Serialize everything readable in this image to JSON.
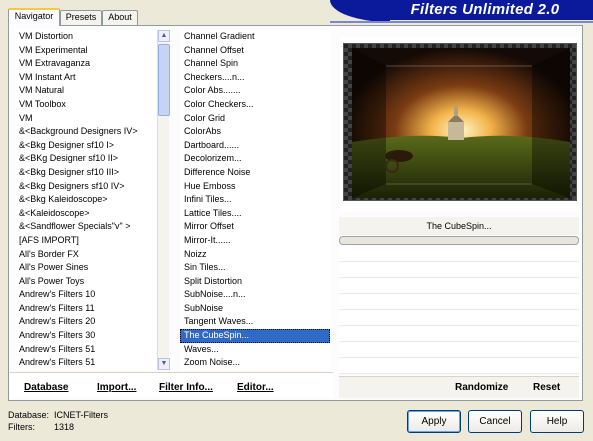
{
  "app": {
    "title": "Filters Unlimited 2.0"
  },
  "tabs": [
    {
      "label": "Navigator",
      "active": true
    },
    {
      "label": "Presets",
      "active": false
    },
    {
      "label": "About",
      "active": false
    }
  ],
  "categories": [
    "VM Distortion",
    "VM Experimental",
    "VM Extravaganza",
    "VM Instant Art",
    "VM Natural",
    "VM Toolbox",
    "VM",
    "&<Background Designers IV>",
    "&<Bkg Designer sf10 I>",
    "&<BKg Designer sf10 II>",
    "&<Bkg Designer sf10 III>",
    "&<Bkg Designers sf10 IV>",
    "&<Bkg Kaleidoscope>",
    "&<Kaleidoscope>",
    "&<Sandflower Specials\"v\" >",
    "[AFS IMPORT]",
    "All's Border FX",
    "All's Power Sines",
    "All's Power Toys",
    "Andrew's Filters 10",
    "Andrew's Filters 11",
    "Andrew's Filters 20",
    "Andrew's Filters 30",
    "Andrew's Filters 51",
    "Andrew's Filters 51"
  ],
  "filters": [
    "Channel Gradient",
    "Channel Offset",
    "Channel Spin",
    "Checkers....n...",
    "Color Abs.......",
    "Color Checkers...",
    "Color Grid",
    "ColorAbs",
    "Dartboard......",
    "Decolorizem...",
    "Difference Noise",
    "Hue Emboss",
    "Infini Tiles...",
    "Lattice Tiles....",
    "Mirror Offset",
    "Mirror-It......",
    "Noizz",
    "Sin Tiles...",
    "Split Distortion",
    "SubNoise....n...",
    "SubNoise",
    "Tangent Waves...",
    "The CubeSpin...",
    "Waves...",
    "Zoom Noise..."
  ],
  "selected_filter": "The CubeSpin...",
  "preview": {
    "filter_name": "The CubeSpin..."
  },
  "toolbar": {
    "database": "Database",
    "import": "Import...",
    "filter_info": "Filter Info...",
    "editor": "Editor...",
    "randomize": "Randomize",
    "reset": "Reset"
  },
  "status": {
    "database_label": "Database:",
    "database_value": "ICNET-Filters",
    "filters_label": "Filters:",
    "filters_value": "1318"
  },
  "buttons": {
    "apply": "Apply",
    "cancel": "Cancel",
    "help": "Help"
  },
  "colors": {
    "banner": "#0a1a9a",
    "selection": "#316ac5",
    "tab_highlight": "#ffc83c"
  }
}
